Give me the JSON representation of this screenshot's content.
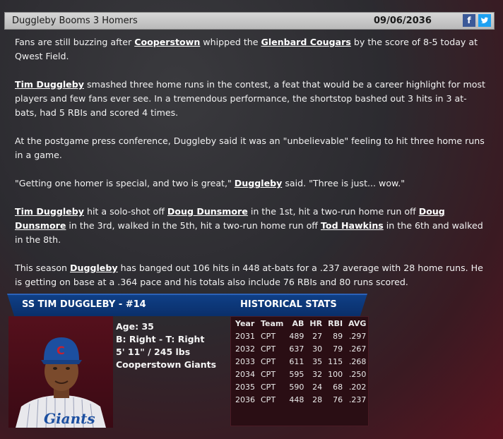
{
  "header": {
    "title": "Duggleby Booms 3 Homers",
    "date": "09/06/2036",
    "social": {
      "facebook": "f",
      "twitter": "t"
    }
  },
  "article": {
    "p1": {
      "t1": "Fans are still buzzing after ",
      "l1": "Cooperstown",
      "t2": " whipped the ",
      "l2": "Glenbard Cougars",
      "t3": " by the score of 8-5 today at Qwest Field."
    },
    "p2": {
      "l1": "Tim Duggleby",
      "t1": " smashed three home runs in the contest, a feat that would be a career highlight for most players and few fans ever see. In a tremendous performance, the shortstop bashed out 3 hits in 3 at-bats, had 5 RBIs and scored 4 times."
    },
    "p3": {
      "t1": "At the postgame press conference, Duggleby said it was an \"unbelievable\" feeling to hit three home runs in a game."
    },
    "p4": {
      "t1": "\"Getting one homer is special, and two is great,\" ",
      "l1": "Duggleby",
      "t2": " said. \"Three is just... wow.\""
    },
    "p5": {
      "l1": "Tim Duggleby",
      "t1": " hit a solo-shot off ",
      "l2": "Doug Dunsmore",
      "t2": " in the 1st, hit a two-run home run off ",
      "l3": "Doug Dunsmore",
      "t3": " in the 3rd, walked in the 5th, hit a two-run home run off ",
      "l4": "Tod Hawkins",
      "t4": " in the 6th and walked in the 8th."
    },
    "p6": {
      "t1": "This season ",
      "l1": "Duggleby",
      "t2": " has banged out 106 hits in 448 at-bats for a .237 average with 28 home runs. He is getting on base at a .364 pace and his totals also include 76 RBIs and 80 runs scored."
    }
  },
  "player_card": {
    "name": "SS TIM DUGGLEBY - #14",
    "section_title": "HISTORICAL STATS",
    "age": "Age: 35",
    "bats_throws": "B: Right - T: Right",
    "height_weight": "5' 11\" / 245 lbs",
    "team": "Cooperstown Giants",
    "cap_letter": "C",
    "jersey_text": "Giants",
    "colors": {
      "cap": "#1c4fa0",
      "jersey_text": "#1c4fa0"
    }
  },
  "stats": {
    "columns": [
      "Year",
      "Team",
      "AB",
      "HR",
      "RBI",
      "AVG"
    ],
    "rows": [
      [
        "2031",
        "CPT",
        "489",
        "27",
        "89",
        ".297"
      ],
      [
        "2032",
        "CPT",
        "637",
        "30",
        "79",
        ".267"
      ],
      [
        "2033",
        "CPT",
        "611",
        "35",
        "115",
        ".268"
      ],
      [
        "2034",
        "CPT",
        "595",
        "32",
        "100",
        ".250"
      ],
      [
        "2035",
        "CPT",
        "590",
        "24",
        "68",
        ".202"
      ],
      [
        "2036",
        "CPT",
        "448",
        "28",
        "76",
        ".237"
      ]
    ]
  }
}
